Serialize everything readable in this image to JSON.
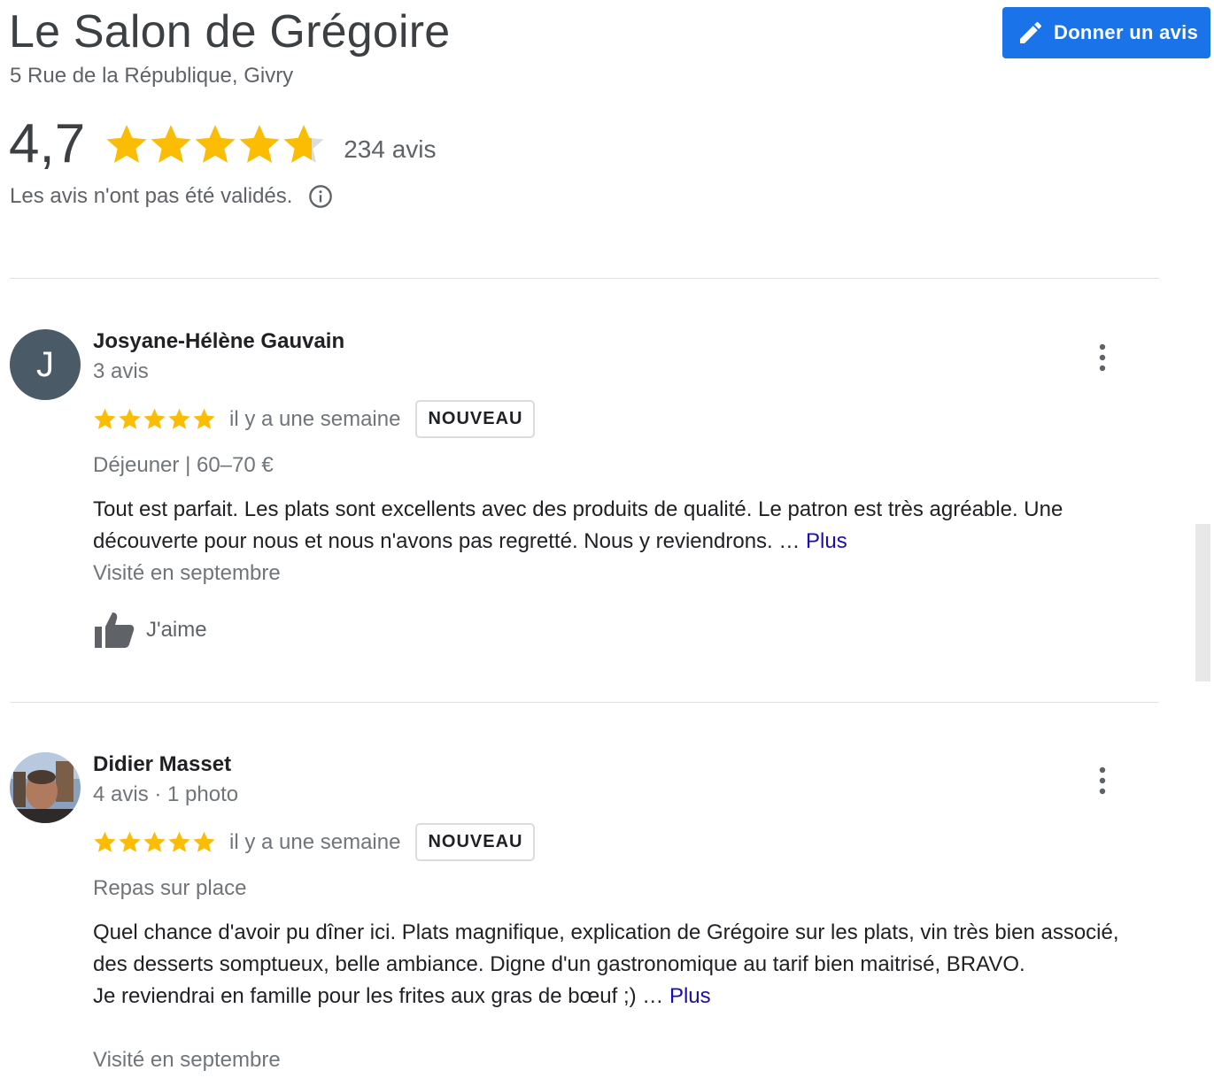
{
  "header": {
    "title": "Le Salon de Grégoire",
    "address": "5 Rue de la République, Givry",
    "write_review_label": "Donner un avis"
  },
  "summary": {
    "rating": "4,7",
    "rating_value": 4.7,
    "count_label": "234 avis",
    "disclaimer": "Les avis n'ont pas été validés."
  },
  "colors": {
    "star": "#fbbc04",
    "star_empty": "#dadce0",
    "accent": "#1a73e8",
    "link": "#1a0dab"
  },
  "reviews": [
    {
      "avatar_letter": "J",
      "name": "Josyane-Hélène Gauvain",
      "meta": "3 avis",
      "stars": 5,
      "ago": "il y a une semaine",
      "badge": "NOUVEAU",
      "meal": "Déjeuner  |  60–70 €",
      "text": "Tout est parfait. Les plats sont excellents avec des produits de qualité. Le patron est très agréable. Une découverte pour nous et nous n'avons pas regretté. Nous y reviendrons. … ",
      "more": "Plus",
      "visited": "Visité en septembre",
      "like_label": "J'aime"
    },
    {
      "avatar_letter": "",
      "name": "Didier Masset",
      "meta": "4 avis · 1 photo",
      "stars": 5,
      "ago": "il y a une semaine",
      "badge": "NOUVEAU",
      "meal": "Repas sur place",
      "text": "Quel chance d'avoir pu dîner ici. Plats magnifique, explication de Grégoire sur les plats, vin très bien associé, des desserts somptueux, belle ambiance. Digne d'un gastronomique au tarif bien maitrisé, BRAVO.\nJe reviendrai en famille pour les frites aux gras de bœuf ;) … ",
      "more": "Plus",
      "visited": "Visité en septembre"
    }
  ]
}
